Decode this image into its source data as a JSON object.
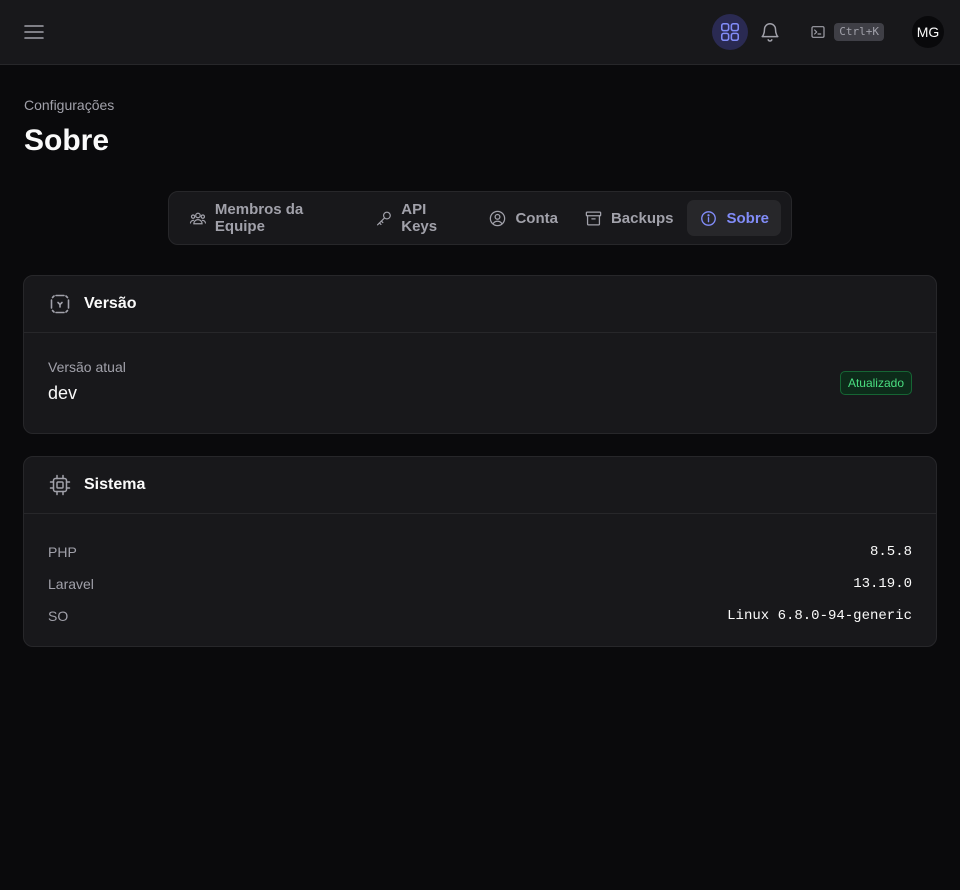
{
  "topbar": {
    "shortcut_label": "Ctrl+K",
    "avatar_initials": "MG",
    "accent_color": "#818cf8"
  },
  "breadcrumb": "Configurações",
  "page_title": "Sobre",
  "tabs": [
    {
      "label": "Membros da Equipe",
      "icon": "users-icon",
      "active": false
    },
    {
      "label": "API Keys",
      "icon": "key-icon",
      "active": false
    },
    {
      "label": "Conta",
      "icon": "user-circle-icon",
      "active": false
    },
    {
      "label": "Backups",
      "icon": "archive-icon",
      "active": false
    },
    {
      "label": "Sobre",
      "icon": "info-icon",
      "active": true
    }
  ],
  "version_card": {
    "title": "Versão",
    "icon": "version-icon",
    "current_label": "Versão atual",
    "current_value": "dev",
    "status_badge": "Atualizado",
    "status_color": "#4ade80"
  },
  "system_card": {
    "title": "Sistema",
    "icon": "cpu-icon",
    "rows": [
      {
        "key": "PHP",
        "value": "8.5.8"
      },
      {
        "key": "Laravel",
        "value": "13.19.0"
      },
      {
        "key": "SO",
        "value": "Linux 6.8.0-94-generic"
      }
    ]
  }
}
